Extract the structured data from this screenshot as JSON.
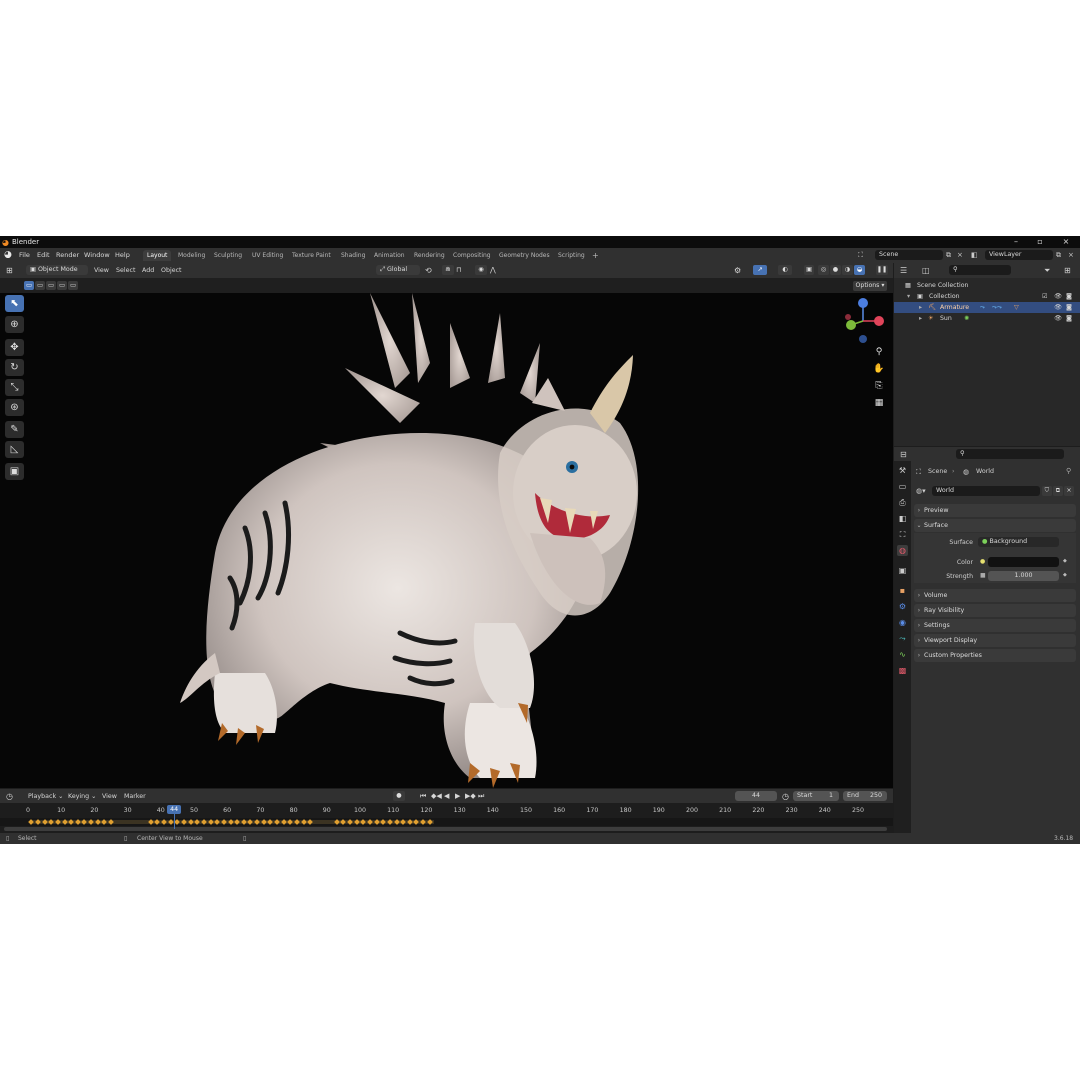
{
  "window": {
    "title": "Blender"
  },
  "menus": [
    "File",
    "Edit",
    "Render",
    "Window",
    "Help"
  ],
  "workspaces": [
    {
      "label": "Layout",
      "active": true
    },
    {
      "label": "Modeling"
    },
    {
      "label": "Sculpting"
    },
    {
      "label": "UV Editing"
    },
    {
      "label": "Texture Paint"
    },
    {
      "label": "Shading"
    },
    {
      "label": "Animation"
    },
    {
      "label": "Rendering"
    },
    {
      "label": "Compositing"
    },
    {
      "label": "Geometry Nodes"
    },
    {
      "label": "Scripting"
    }
  ],
  "add_workspace": "+",
  "scene_field": "Scene",
  "viewlayer_field": "ViewLayer",
  "viewport_header": {
    "mode": "Object Mode",
    "view": "View",
    "select": "Select",
    "add": "Add",
    "object": "Object",
    "transform": "Global",
    "options": "Options"
  },
  "outliner": {
    "root": "Scene Collection",
    "collection": "Collection",
    "items": [
      {
        "label": "Armature",
        "selected": true
      },
      {
        "label": "Sun",
        "selected": false
      }
    ]
  },
  "properties": {
    "breadcrumb_scene": "Scene",
    "breadcrumb_world": "World",
    "world_name": "World",
    "panels": {
      "preview": "Preview",
      "surface": "Surface",
      "volume": "Volume",
      "ray_visibility": "Ray Visibility",
      "settings": "Settings",
      "viewport_display": "Viewport Display",
      "custom_properties": "Custom Properties"
    },
    "surface_label": "Surface",
    "surface_value": "Background",
    "color_label": "Color",
    "strength_label": "Strength",
    "strength_value": "1.000"
  },
  "timeline": {
    "playback": "Playback",
    "keying": "Keying",
    "view": "View",
    "marker": "Marker",
    "current_frame": "44",
    "start_label": "Start",
    "start_value": "1",
    "end_label": "End",
    "end_value": "250",
    "ticks": [
      "0",
      "10",
      "20",
      "30",
      "40",
      "50",
      "60",
      "70",
      "80",
      "90",
      "100",
      "110",
      "120",
      "130",
      "140",
      "150",
      "160",
      "170",
      "180",
      "190",
      "200",
      "210",
      "220",
      "230",
      "240",
      "250"
    ],
    "frame_min": 0,
    "frame_max": 250
  },
  "status": {
    "left": "Select",
    "middle": "Center View to Mouse",
    "version": "3.6.18"
  },
  "colors": {
    "accent": "#4772b3",
    "selection": "#334d80",
    "keyframe": "#e0a030",
    "playhead": "#4772b3"
  }
}
